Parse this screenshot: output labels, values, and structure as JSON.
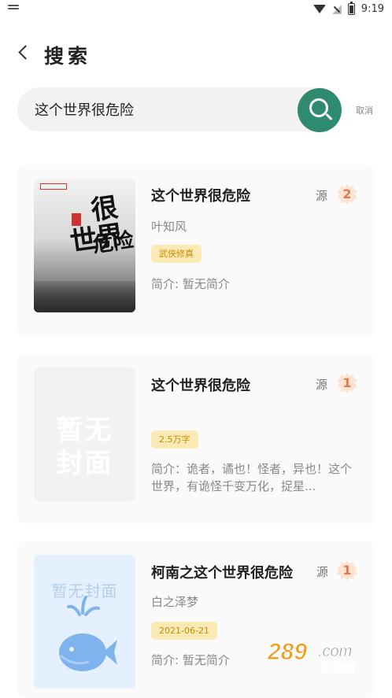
{
  "status_bar": {
    "time": "9:19"
  },
  "header": {
    "title": "搜索"
  },
  "search": {
    "query": "这个世界很危险",
    "cancel_label": "取消"
  },
  "results": [
    {
      "title": "这个世界很危险",
      "source_label": "源",
      "source_count": "2",
      "author": "叶知风",
      "tag": "武侠修真",
      "intro": "简介: 暂无简介",
      "cover_text": [
        "很",
        "世界",
        "危险"
      ]
    },
    {
      "title": "这个世界很危险",
      "source_label": "源",
      "source_count": "1",
      "author": "",
      "tag": "2.5万字",
      "intro": "简介：诡者，谲也！怪者，异也！这个世界，有诡怪千变万化，捉星...",
      "cover_placeholder": [
        "暂无",
        "封面"
      ]
    },
    {
      "title": "柯南之这个世界很危险",
      "source_label": "源",
      "source_count": "1",
      "author": "白之泽梦",
      "tag": "2021-06-21",
      "intro": "简介: 暂无简介",
      "cover_placeholder": "暂无封面"
    }
  ],
  "colors": {
    "accent": "#2e8b70",
    "tag_bg": "#fbeab4",
    "tag_text": "#c88a00",
    "badge": "#e07b4e"
  },
  "watermark": {
    "text": "289.com",
    "subtext": "手游网"
  }
}
